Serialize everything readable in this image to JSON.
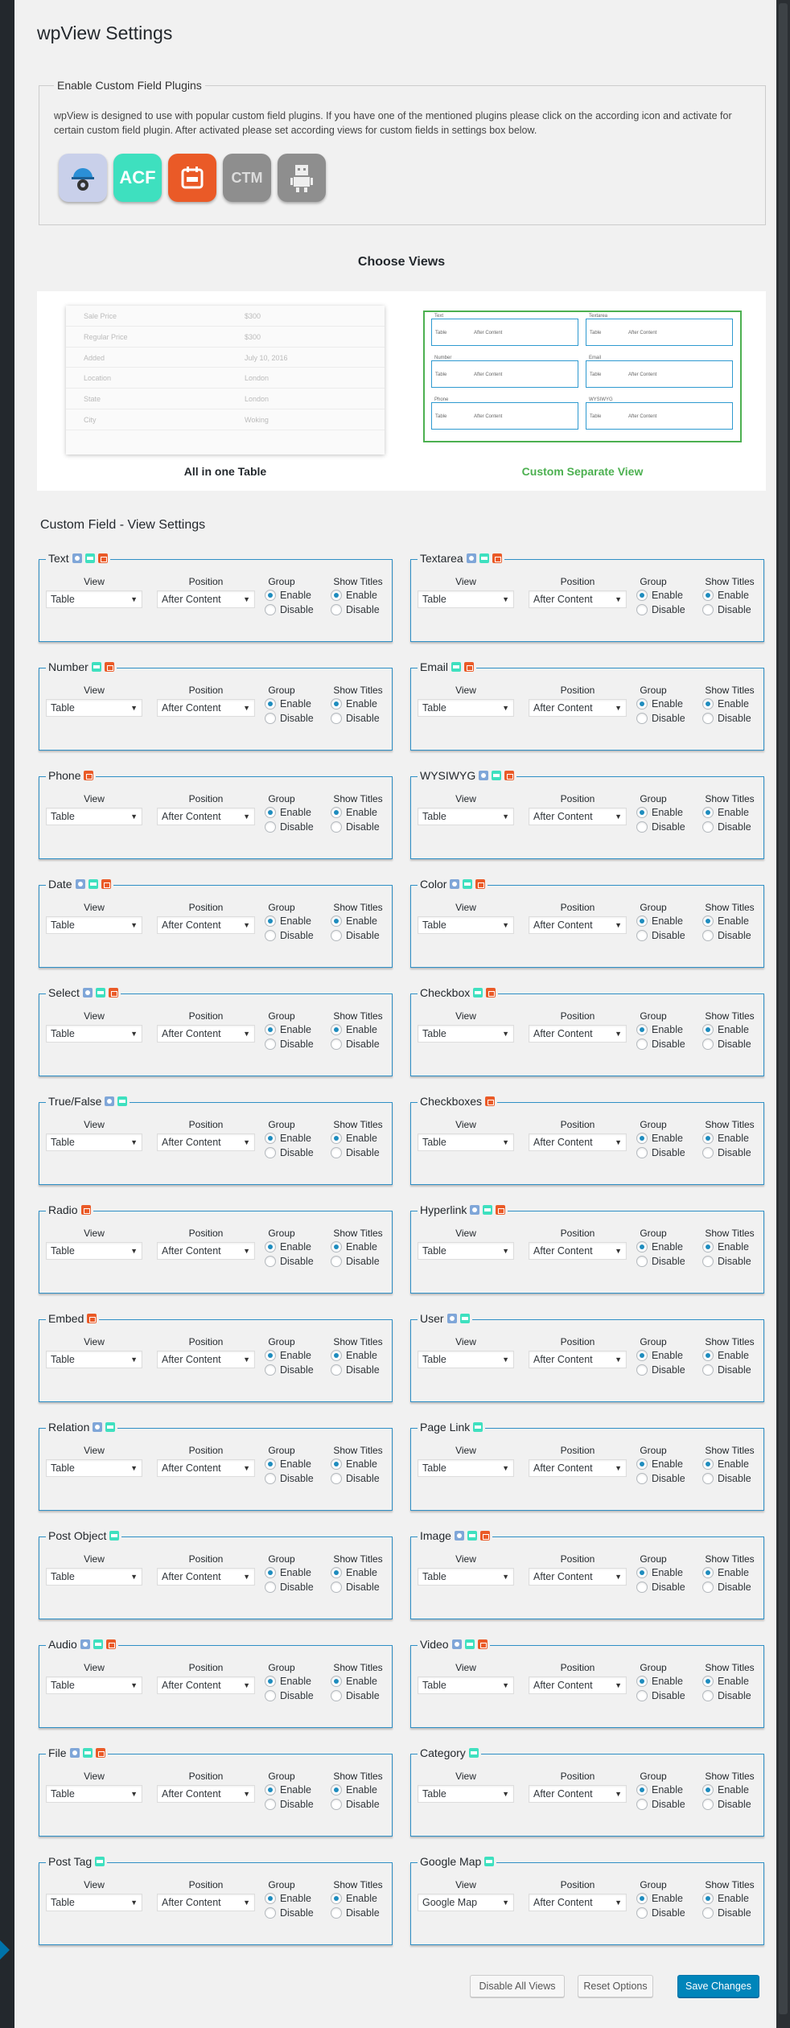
{
  "page": {
    "title": "wpView Settings"
  },
  "plugins": {
    "legend": "Enable Custom Field Plugins",
    "description": "wpView is designed to use with popular custom field plugins. If you have one of the mentioned plugins please click on the according icon and activate for certain custom field plugin. After activated please set according views for custom fields in settings box below.",
    "icons": [
      {
        "name": "types-icon",
        "label": ""
      },
      {
        "name": "acf-icon",
        "label": "ACF"
      },
      {
        "name": "pods-icon",
        "label": ""
      },
      {
        "name": "ctm-icon",
        "label": "CTM"
      },
      {
        "name": "robot-icon",
        "label": ""
      }
    ]
  },
  "views": {
    "heading": "Choose Views",
    "table_caption": "All in one Table",
    "custom_caption": "Custom Separate View",
    "table_preview_rows": [
      {
        "key": "Sale Price",
        "value": "$300"
      },
      {
        "key": "Regular Price",
        "value": "$300"
      },
      {
        "key": "Added",
        "value": "July 10, 2016"
      },
      {
        "key": "Location",
        "value": "London"
      },
      {
        "key": "State",
        "value": "London"
      },
      {
        "key": "City",
        "value": "Woking"
      }
    ]
  },
  "settings": {
    "heading": "Custom Field - View Settings",
    "col_view": "View",
    "col_position": "Position",
    "col_group": "Group",
    "col_titles": "Show Titles",
    "enable": "Enable",
    "disable": "Disable",
    "fields": [
      {
        "label": "Text",
        "badges": [
          "types",
          "acf",
          "pods"
        ],
        "view": "Table",
        "position": "After Content"
      },
      {
        "label": "Textarea",
        "badges": [
          "types",
          "acf",
          "pods"
        ],
        "view": "Table",
        "position": "After Content"
      },
      {
        "label": "Number",
        "badges": [
          "acf",
          "pods"
        ],
        "view": "Table",
        "position": "After Content"
      },
      {
        "label": "Email",
        "badges": [
          "acf",
          "pods"
        ],
        "view": "Table",
        "position": "After Content"
      },
      {
        "label": "Phone",
        "badges": [
          "pods"
        ],
        "view": "Table",
        "position": "After Content"
      },
      {
        "label": "WYSIWYG",
        "badges": [
          "types",
          "acf",
          "pods"
        ],
        "view": "Table",
        "position": "After Content"
      },
      {
        "label": "Date",
        "badges": [
          "types",
          "acf",
          "pods"
        ],
        "view": "Table",
        "position": "After Content"
      },
      {
        "label": "Color",
        "badges": [
          "types",
          "acf",
          "pods"
        ],
        "view": "Table",
        "position": "After Content"
      },
      {
        "label": "Select",
        "badges": [
          "types",
          "acf",
          "pods"
        ],
        "view": "Table",
        "position": "After Content"
      },
      {
        "label": "Checkbox",
        "badges": [
          "acf",
          "pods"
        ],
        "view": "Table",
        "position": "After Content"
      },
      {
        "label": "True/False",
        "badges": [
          "types",
          "acf"
        ],
        "view": "Table",
        "position": "After Content"
      },
      {
        "label": "Checkboxes",
        "badges": [
          "pods"
        ],
        "view": "Table",
        "position": "After Content"
      },
      {
        "label": "Radio",
        "badges": [
          "pods"
        ],
        "view": "Table",
        "position": "After Content"
      },
      {
        "label": "Hyperlink",
        "badges": [
          "types",
          "acf",
          "pods"
        ],
        "view": "Table",
        "position": "After Content"
      },
      {
        "label": "Embed",
        "badges": [
          "pods"
        ],
        "view": "Table",
        "position": "After Content"
      },
      {
        "label": "User",
        "badges": [
          "types",
          "acf"
        ],
        "view": "Table",
        "position": "After Content"
      },
      {
        "label": "Relation",
        "badges": [
          "types",
          "acf"
        ],
        "view": "Table",
        "position": "After Content"
      },
      {
        "label": "Page Link",
        "badges": [
          "acf"
        ],
        "view": "Table",
        "position": "After Content"
      },
      {
        "label": "Post Object",
        "badges": [
          "acf"
        ],
        "view": "Table",
        "position": "After Content"
      },
      {
        "label": "Image",
        "badges": [
          "types",
          "acf",
          "pods"
        ],
        "view": "Table",
        "position": "After Content"
      },
      {
        "label": "Audio",
        "badges": [
          "types",
          "acf",
          "pods"
        ],
        "view": "Table",
        "position": "After Content"
      },
      {
        "label": "Video",
        "badges": [
          "types",
          "acf",
          "pods"
        ],
        "view": "Table",
        "position": "After Content"
      },
      {
        "label": "File",
        "badges": [
          "types",
          "acf",
          "pods"
        ],
        "view": "Table",
        "position": "After Content"
      },
      {
        "label": "Category",
        "badges": [
          "acf"
        ],
        "view": "Table",
        "position": "After Content"
      },
      {
        "label": "Post Tag",
        "badges": [
          "acf"
        ],
        "view": "Table",
        "position": "After Content"
      },
      {
        "label": "Google Map",
        "badges": [
          "acf"
        ],
        "view": "Google Map",
        "position": "After Content"
      }
    ]
  },
  "actions": {
    "disable_all": "Disable All Views",
    "reset": "Reset Options",
    "save": "Save Changes"
  },
  "colors": {
    "accent": "#0085ba",
    "box_border": "#2e8fc6",
    "custom_view_green": "#4cb050",
    "acf": "#3ee0bf",
    "pods": "#ea5a27",
    "types": "#7fa6d8"
  }
}
